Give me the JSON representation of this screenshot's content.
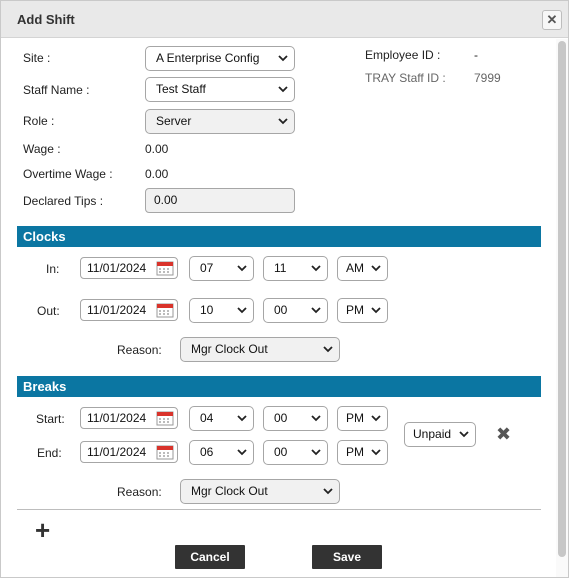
{
  "dialog": {
    "title": "Add Shift",
    "close_glyph": "✕"
  },
  "form": {
    "site_label": "Site :",
    "site_value": "A Enterprise Config",
    "staff_label": "Staff Name :",
    "staff_value": "Test Staff",
    "role_label": "Role :",
    "role_value": "Server",
    "wage_label": "Wage :",
    "wage_value": "0.00",
    "overtime_label": "Overtime Wage :",
    "overtime_value": "0.00",
    "tips_label": "Declared Tips :",
    "tips_value": "0.00",
    "employee_id_label": "Employee ID :",
    "employee_id_value": "-",
    "tray_id_label": "TRAY Staff ID :",
    "tray_id_value": "7999"
  },
  "clocks": {
    "header": "Clocks",
    "in_label": "In:",
    "in_date": "11/01/2024",
    "in_hour": "07",
    "in_minute": "11",
    "in_ampm": "AM",
    "out_label": "Out:",
    "out_date": "11/01/2024",
    "out_hour": "10",
    "out_minute": "00",
    "out_ampm": "PM",
    "reason_label": "Reason:",
    "reason_value": "Mgr Clock Out"
  },
  "breaks": {
    "header": "Breaks",
    "start_label": "Start:",
    "start_date": "11/01/2024",
    "start_hour": "04",
    "start_minute": "00",
    "start_ampm": "PM",
    "end_label": "End:",
    "end_date": "11/01/2024",
    "end_hour": "06",
    "end_minute": "00",
    "end_ampm": "PM",
    "paid_value": "Unpaid",
    "remove_glyph": "✖",
    "reason_label": "Reason:",
    "reason_value": "Mgr Clock Out"
  },
  "actions": {
    "add_glyph": "+",
    "cancel_label": "Cancel",
    "save_label": "Save"
  },
  "icons": {
    "close": "close-icon",
    "calendar": "calendar-icon",
    "chevron": "chevron-down-icon",
    "remove": "remove-icon",
    "add": "plus-icon"
  },
  "colors": {
    "section_header": "#0b76a2",
    "button": "#333333",
    "titlebar": "#e9e9e9"
  }
}
